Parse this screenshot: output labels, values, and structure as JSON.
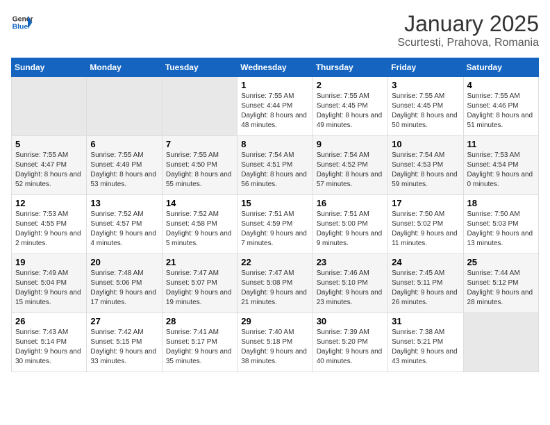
{
  "logo": {
    "line1": "General",
    "line2": "Blue"
  },
  "title": "January 2025",
  "subtitle": "Scurtesti, Prahova, Romania",
  "weekdays": [
    "Sunday",
    "Monday",
    "Tuesday",
    "Wednesday",
    "Thursday",
    "Friday",
    "Saturday"
  ],
  "weeks": [
    [
      {
        "day": "",
        "info": ""
      },
      {
        "day": "",
        "info": ""
      },
      {
        "day": "",
        "info": ""
      },
      {
        "day": "1",
        "info": "Sunrise: 7:55 AM\nSunset: 4:44 PM\nDaylight: 8 hours\nand 48 minutes."
      },
      {
        "day": "2",
        "info": "Sunrise: 7:55 AM\nSunset: 4:45 PM\nDaylight: 8 hours\nand 49 minutes."
      },
      {
        "day": "3",
        "info": "Sunrise: 7:55 AM\nSunset: 4:45 PM\nDaylight: 8 hours\nand 50 minutes."
      },
      {
        "day": "4",
        "info": "Sunrise: 7:55 AM\nSunset: 4:46 PM\nDaylight: 8 hours\nand 51 minutes."
      }
    ],
    [
      {
        "day": "5",
        "info": "Sunrise: 7:55 AM\nSunset: 4:47 PM\nDaylight: 8 hours\nand 52 minutes."
      },
      {
        "day": "6",
        "info": "Sunrise: 7:55 AM\nSunset: 4:49 PM\nDaylight: 8 hours\nand 53 minutes."
      },
      {
        "day": "7",
        "info": "Sunrise: 7:55 AM\nSunset: 4:50 PM\nDaylight: 8 hours\nand 55 minutes."
      },
      {
        "day": "8",
        "info": "Sunrise: 7:54 AM\nSunset: 4:51 PM\nDaylight: 8 hours\nand 56 minutes."
      },
      {
        "day": "9",
        "info": "Sunrise: 7:54 AM\nSunset: 4:52 PM\nDaylight: 8 hours\nand 57 minutes."
      },
      {
        "day": "10",
        "info": "Sunrise: 7:54 AM\nSunset: 4:53 PM\nDaylight: 8 hours\nand 59 minutes."
      },
      {
        "day": "11",
        "info": "Sunrise: 7:53 AM\nSunset: 4:54 PM\nDaylight: 9 hours\nand 0 minutes."
      }
    ],
    [
      {
        "day": "12",
        "info": "Sunrise: 7:53 AM\nSunset: 4:55 PM\nDaylight: 9 hours\nand 2 minutes."
      },
      {
        "day": "13",
        "info": "Sunrise: 7:52 AM\nSunset: 4:57 PM\nDaylight: 9 hours\nand 4 minutes."
      },
      {
        "day": "14",
        "info": "Sunrise: 7:52 AM\nSunset: 4:58 PM\nDaylight: 9 hours\nand 5 minutes."
      },
      {
        "day": "15",
        "info": "Sunrise: 7:51 AM\nSunset: 4:59 PM\nDaylight: 9 hours\nand 7 minutes."
      },
      {
        "day": "16",
        "info": "Sunrise: 7:51 AM\nSunset: 5:00 PM\nDaylight: 9 hours\nand 9 minutes."
      },
      {
        "day": "17",
        "info": "Sunrise: 7:50 AM\nSunset: 5:02 PM\nDaylight: 9 hours\nand 11 minutes."
      },
      {
        "day": "18",
        "info": "Sunrise: 7:50 AM\nSunset: 5:03 PM\nDaylight: 9 hours\nand 13 minutes."
      }
    ],
    [
      {
        "day": "19",
        "info": "Sunrise: 7:49 AM\nSunset: 5:04 PM\nDaylight: 9 hours\nand 15 minutes."
      },
      {
        "day": "20",
        "info": "Sunrise: 7:48 AM\nSunset: 5:06 PM\nDaylight: 9 hours\nand 17 minutes."
      },
      {
        "day": "21",
        "info": "Sunrise: 7:47 AM\nSunset: 5:07 PM\nDaylight: 9 hours\nand 19 minutes."
      },
      {
        "day": "22",
        "info": "Sunrise: 7:47 AM\nSunset: 5:08 PM\nDaylight: 9 hours\nand 21 minutes."
      },
      {
        "day": "23",
        "info": "Sunrise: 7:46 AM\nSunset: 5:10 PM\nDaylight: 9 hours\nand 23 minutes."
      },
      {
        "day": "24",
        "info": "Sunrise: 7:45 AM\nSunset: 5:11 PM\nDaylight: 9 hours\nand 26 minutes."
      },
      {
        "day": "25",
        "info": "Sunrise: 7:44 AM\nSunset: 5:12 PM\nDaylight: 9 hours\nand 28 minutes."
      }
    ],
    [
      {
        "day": "26",
        "info": "Sunrise: 7:43 AM\nSunset: 5:14 PM\nDaylight: 9 hours\nand 30 minutes."
      },
      {
        "day": "27",
        "info": "Sunrise: 7:42 AM\nSunset: 5:15 PM\nDaylight: 9 hours\nand 33 minutes."
      },
      {
        "day": "28",
        "info": "Sunrise: 7:41 AM\nSunset: 5:17 PM\nDaylight: 9 hours\nand 35 minutes."
      },
      {
        "day": "29",
        "info": "Sunrise: 7:40 AM\nSunset: 5:18 PM\nDaylight: 9 hours\nand 38 minutes."
      },
      {
        "day": "30",
        "info": "Sunrise: 7:39 AM\nSunset: 5:20 PM\nDaylight: 9 hours\nand 40 minutes."
      },
      {
        "day": "31",
        "info": "Sunrise: 7:38 AM\nSunset: 5:21 PM\nDaylight: 9 hours\nand 43 minutes."
      },
      {
        "day": "",
        "info": ""
      }
    ]
  ]
}
